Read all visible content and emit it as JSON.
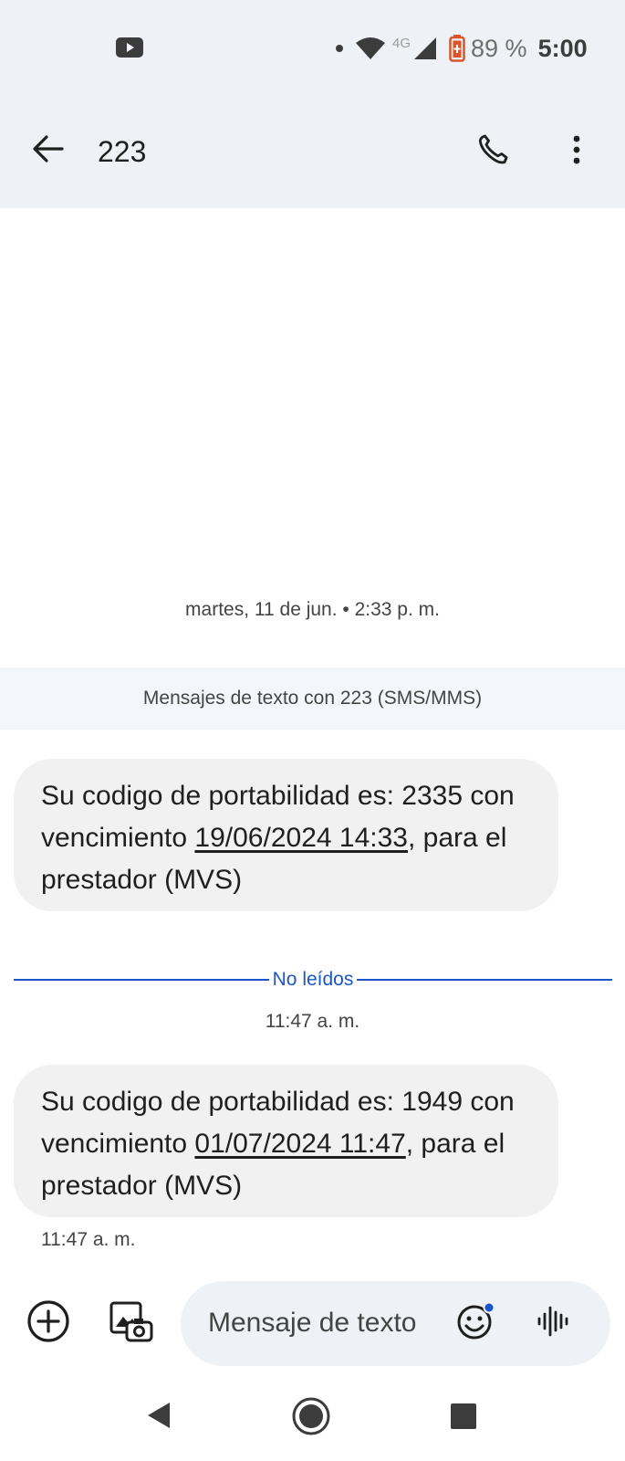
{
  "status_bar": {
    "network": "4G",
    "battery_percent": "89 %",
    "time": "5:00",
    "icons": [
      "youtube-icon",
      "notification-dot-icon",
      "wifi-icon",
      "signal-icon",
      "battery-icon"
    ]
  },
  "app_bar": {
    "title": "223",
    "icons": [
      "back-arrow-icon",
      "phone-icon",
      "more-vert-icon"
    ]
  },
  "conversation": {
    "date_separator": "martes, 11 de jun. • 2:33 p. m.",
    "sms_banner": "Mensajes de texto con 223 (SMS/MMS)",
    "messages": [
      {
        "text_before": "Su codigo de portabilidad es: 2335 con vencimiento ",
        "link": "19/06/2024 14:33",
        "text_after": ", para el prestador (MVS)"
      },
      {
        "text_before": "Su codigo de portabilidad es: 1949 con vencimiento ",
        "link": "01/07/2024 11:47",
        "text_after": ", para el prestador (MVS)"
      }
    ],
    "unread_label": "No leídos",
    "unread_time": "11:47 a. m.",
    "last_message_time": "11:47 a. m."
  },
  "composer": {
    "placeholder": "Mensaje de texto",
    "icons": [
      "add-circle-icon",
      "gallery-icon",
      "emoji-icon",
      "voice-icon"
    ],
    "accent_color": "#1a56c7"
  },
  "nav_bar": {
    "icons": [
      "nav-back-icon",
      "nav-home-icon",
      "nav-recents-icon"
    ]
  }
}
